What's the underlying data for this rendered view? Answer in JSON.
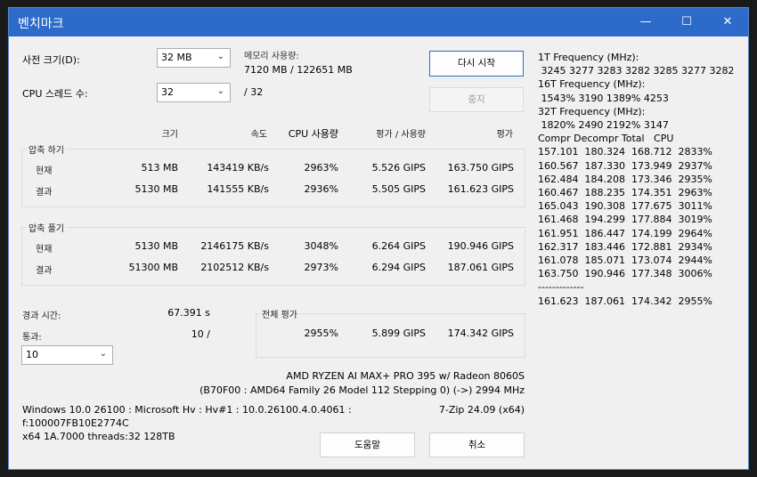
{
  "window": {
    "title": "벤치마크",
    "minimize": "—",
    "maximize": "☐",
    "close": "✕"
  },
  "dict": {
    "label": "사전 크기(D):",
    "value": "32 MB"
  },
  "threads": {
    "label": "CPU 스레드 수:",
    "value": "32",
    "total": "/ 32"
  },
  "memory": {
    "label": "메모리 사용량:",
    "value": "7120 MB / 122651 MB"
  },
  "buttons": {
    "restart": "다시 시작",
    "stop": "중지",
    "help": "도움말",
    "cancel": "취소"
  },
  "headers": {
    "size": "크기",
    "speed": "속도",
    "cpu": "CPU 사용량",
    "rating_usage": "평가 / 사용량",
    "rating": "평가"
  },
  "compress": {
    "label": "압축 하기",
    "rows": [
      {
        "name": "현재",
        "size": "513 MB",
        "speed": "143419 KB/s",
        "cpu": "2963%",
        "rpu": "5.526 GIPS",
        "rating": "163.750 GIPS"
      },
      {
        "name": "결과",
        "size": "5130 MB",
        "speed": "141555 KB/s",
        "cpu": "2936%",
        "rpu": "5.505 GIPS",
        "rating": "161.623 GIPS"
      }
    ]
  },
  "decompress": {
    "label": "압축 풀기",
    "rows": [
      {
        "name": "현재",
        "size": "5130 MB",
        "speed": "2146175 KB/s",
        "cpu": "3048%",
        "rpu": "6.264 GIPS",
        "rating": "190.946 GIPS"
      },
      {
        "name": "결과",
        "size": "51300 MB",
        "speed": "2102512 KB/s",
        "cpu": "2973%",
        "rpu": "6.294 GIPS",
        "rating": "187.061 GIPS"
      }
    ]
  },
  "elapsed": {
    "label": "경과 시간:",
    "value": "67.391 s"
  },
  "passes": {
    "label": "통과:",
    "value": "10 /",
    "combo": "10"
  },
  "total": {
    "label": "전체 평가",
    "cpu": "2955%",
    "rpu": "5.899 GIPS",
    "rating": "174.342 GIPS"
  },
  "cpu_info": {
    "line1": "AMD RYZEN AI MAX+ PRO 395 w/ Radeon 8060S",
    "line2": "(B70F00 : AMD64 Family 26 Model 112 Stepping 0) (->) 2994 MHz"
  },
  "sys_info": {
    "line1": "Windows 10.0 26100 : Microsoft Hv : Hv#1 : 10.0.26100.4.0.4061 :",
    "line2": "f:100007FB10E2774C",
    "line3": "x64 1A.7000 threads:32 128TB",
    "version": "7-Zip 24.09 (x64)"
  },
  "log": [
    "1T Frequency (MHz):",
    " 3245 3277 3283 3282 3285 3277 3282",
    "16T Frequency (MHz):",
    " 1543% 3190 1389% 4253",
    "32T Frequency (MHz):",
    " 1820% 2490 2192% 3147",
    "Compr Decompr Total   CPU",
    "157.101  180.324  168.712  2833%",
    "160.567  187.330  173.949  2937%",
    "162.484  184.208  173.346  2935%",
    "160.467  188.235  174.351  2963%",
    "165.043  190.308  177.675  3011%",
    "161.468  194.299  177.884  3019%",
    "161.951  186.447  174.199  2964%",
    "162.317  183.446  172.881  2934%",
    "161.078  185.071  173.074  2944%",
    "163.750  190.946  177.348  3006%",
    "-------------",
    "161.623  187.061  174.342  2955%"
  ]
}
